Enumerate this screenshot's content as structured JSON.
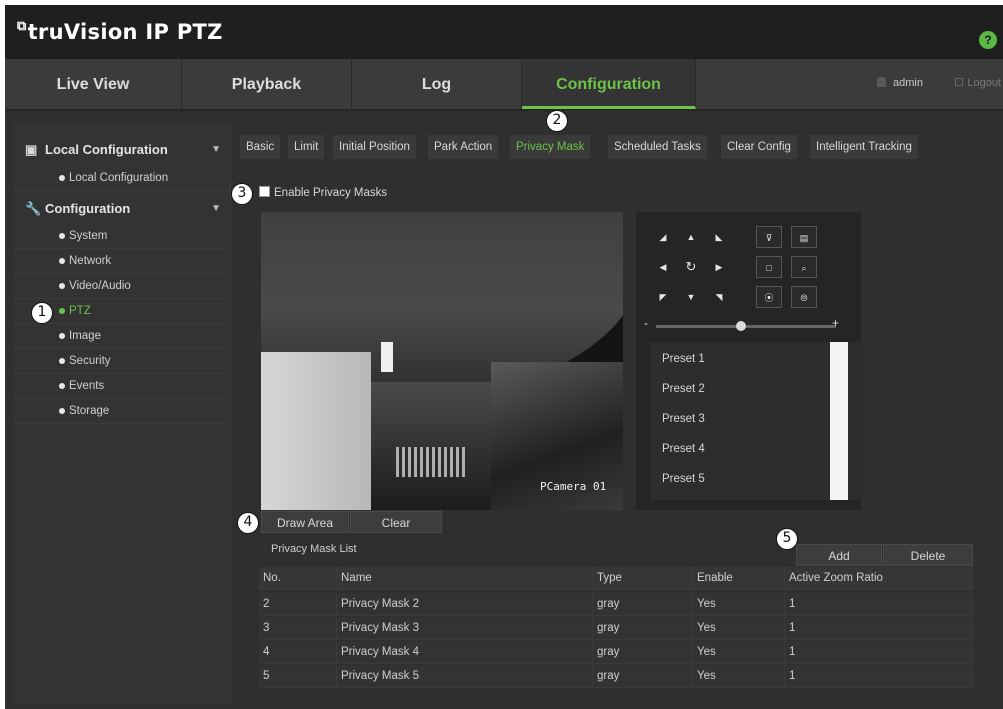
{
  "app": {
    "title": "truVision IP PTZ",
    "logo_mark": "⧉",
    "help_icon": "question-circle-icon",
    "accent_color": "#6cc24a"
  },
  "nav": {
    "tabs": [
      {
        "label": "Live View"
      },
      {
        "label": "Playback"
      },
      {
        "label": "Log"
      },
      {
        "label": "Configuration",
        "active": true
      }
    ],
    "user": "admin",
    "logout": "Logout"
  },
  "sidebar": {
    "groups": [
      {
        "label": "Local Configuration",
        "icon": "local-config-icon",
        "items": [
          {
            "label": "Local Configuration"
          }
        ]
      },
      {
        "label": "Configuration",
        "icon": "wrench-icon",
        "items": [
          {
            "label": "System"
          },
          {
            "label": "Network"
          },
          {
            "label": "Video/Audio"
          },
          {
            "label": "PTZ",
            "active": true
          },
          {
            "label": "Image"
          },
          {
            "label": "Security"
          },
          {
            "label": "Events"
          },
          {
            "label": "Storage"
          }
        ]
      }
    ]
  },
  "callouts": [
    "1",
    "2",
    "3",
    "4",
    "5"
  ],
  "subtabs": [
    {
      "label": "Basic"
    },
    {
      "label": "Limit"
    },
    {
      "label": "Initial Position"
    },
    {
      "label": "Park Action"
    },
    {
      "label": "Privacy Mask",
      "active": true
    },
    {
      "label": "Scheduled Tasks"
    },
    {
      "label": "Clear Config"
    },
    {
      "label": "Intelligent Tracking"
    }
  ],
  "privacy": {
    "enable_label": "Enable Privacy Masks",
    "enabled": false,
    "camera_label": "PCamera 01",
    "draw_area": "Draw Area",
    "clear": "Clear",
    "list_title": "Privacy Mask List",
    "add": "Add",
    "delete": "Delete"
  },
  "ptz": {
    "zoom_minus": "-",
    "zoom_plus": "+",
    "zoom_level": 0.47,
    "presets": [
      "Preset 1",
      "Preset 2",
      "Preset 3",
      "Preset 4",
      "Preset 5"
    ]
  },
  "table": {
    "columns": [
      "No.",
      "Name",
      "Type",
      "Enable",
      "Active Zoom Ratio"
    ],
    "rows": [
      [
        "2",
        "Privacy Mask 2",
        "gray",
        "Yes",
        "1"
      ],
      [
        "3",
        "Privacy Mask 3",
        "gray",
        "Yes",
        "1"
      ],
      [
        "4",
        "Privacy Mask 4",
        "gray",
        "Yes",
        "1"
      ],
      [
        "5",
        "Privacy Mask 5",
        "gray",
        "Yes",
        "1"
      ]
    ]
  }
}
